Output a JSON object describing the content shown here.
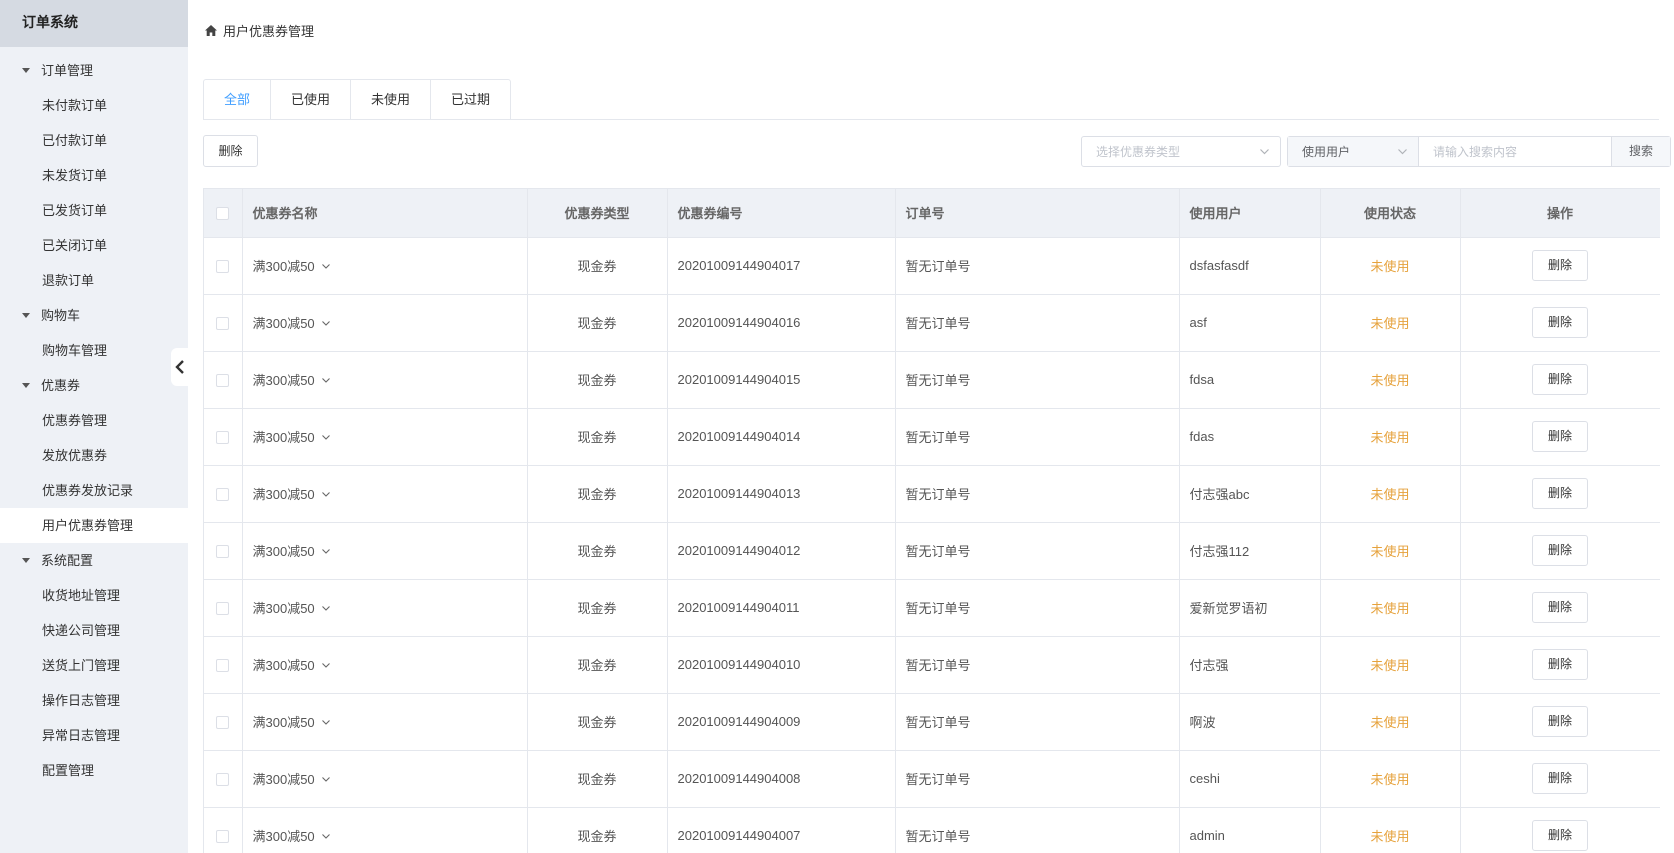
{
  "app": {
    "title": "订单系统"
  },
  "sidebar": {
    "groups": [
      {
        "label": "订单管理",
        "items": [
          "未付款订单",
          "已付款订单",
          "未发货订单",
          "已发货订单",
          "已关闭订单",
          "退款订单"
        ]
      },
      {
        "label": "购物车",
        "items": [
          "购物车管理"
        ]
      },
      {
        "label": "优惠券",
        "items": [
          "优惠券管理",
          "发放优惠券",
          "优惠券发放记录",
          "用户优惠券管理"
        ]
      },
      {
        "label": "系统配置",
        "items": [
          "收货地址管理",
          "快递公司管理",
          "送货上门管理",
          "操作日志管理",
          "异常日志管理",
          "配置管理"
        ]
      }
    ],
    "active_item": "用户优惠券管理"
  },
  "breadcrumb": {
    "label": "用户优惠券管理",
    "icon": "home-icon"
  },
  "tabs": [
    "全部",
    "已使用",
    "未使用",
    "已过期"
  ],
  "active_tab": "全部",
  "toolbar": {
    "delete_label": "删除",
    "type_select_placeholder": "选择优惠券类型",
    "user_select_value": "使用用户",
    "search_placeholder": "请输入搜索内容",
    "search_label": "搜索"
  },
  "table": {
    "columns": [
      "优惠券名称",
      "优惠券类型",
      "优惠券编号",
      "订单号",
      "使用用户",
      "使用状态",
      "操作"
    ],
    "rows": [
      {
        "name": "满300减50",
        "type": "现金券",
        "code": "20201009144904017",
        "order": "暂无订单号",
        "user": "dsfasfasdf",
        "status": "未使用",
        "action": "删除"
      },
      {
        "name": "满300减50",
        "type": "现金券",
        "code": "20201009144904016",
        "order": "暂无订单号",
        "user": "asf",
        "status": "未使用",
        "action": "删除"
      },
      {
        "name": "满300减50",
        "type": "现金券",
        "code": "20201009144904015",
        "order": "暂无订单号",
        "user": "fdsa",
        "status": "未使用",
        "action": "删除"
      },
      {
        "name": "满300减50",
        "type": "现金券",
        "code": "20201009144904014",
        "order": "暂无订单号",
        "user": "fdas",
        "status": "未使用",
        "action": "删除"
      },
      {
        "name": "满300减50",
        "type": "现金券",
        "code": "20201009144904013",
        "order": "暂无订单号",
        "user": "付志强abc",
        "status": "未使用",
        "action": "删除"
      },
      {
        "name": "满300减50",
        "type": "现金券",
        "code": "20201009144904012",
        "order": "暂无订单号",
        "user": "付志强112",
        "status": "未使用",
        "action": "删除"
      },
      {
        "name": "满300减50",
        "type": "现金券",
        "code": "20201009144904011",
        "order": "暂无订单号",
        "user": "爱新觉罗语初",
        "status": "未使用",
        "action": "删除"
      },
      {
        "name": "满300减50",
        "type": "现金券",
        "code": "20201009144904010",
        "order": "暂无订单号",
        "user": "付志强",
        "status": "未使用",
        "action": "删除"
      },
      {
        "name": "满300减50",
        "type": "现金券",
        "code": "20201009144904009",
        "order": "暂无订单号",
        "user": "啊波",
        "status": "未使用",
        "action": "删除"
      },
      {
        "name": "满300减50",
        "type": "现金券",
        "code": "20201009144904008",
        "order": "暂无订单号",
        "user": "ceshi",
        "status": "未使用",
        "action": "删除"
      },
      {
        "name": "满300减50",
        "type": "现金券",
        "code": "20201009144904007",
        "order": "暂无订单号",
        "user": "admin",
        "status": "未使用",
        "action": "删除"
      }
    ]
  },
  "colors": {
    "accent": "#409eff",
    "status_unused": "#e6a23c",
    "sidebar_bg": "#eef1f6",
    "header_bg": "#eef1f6"
  }
}
